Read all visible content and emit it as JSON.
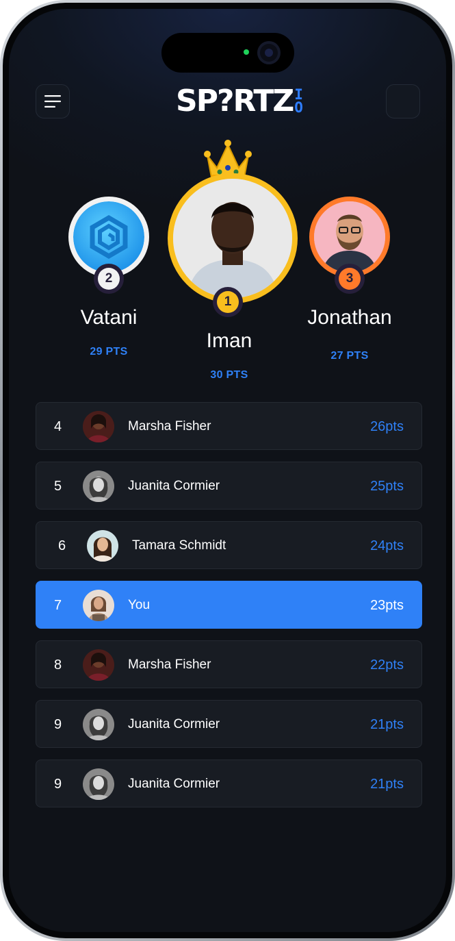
{
  "app": {
    "logo_main": "SP?RTZ",
    "logo_sub_top": "I",
    "logo_sub_bottom": "O"
  },
  "header": {
    "menu_icon": "hamburger-menu-icon"
  },
  "podium": {
    "first": {
      "rank": "1",
      "name": "Iman",
      "points": "30 PTS",
      "icon": "crown-icon",
      "ring_color": "#f9be1e"
    },
    "second": {
      "rank": "2",
      "name": "Vatani",
      "points": "29 PTS",
      "ring_color": "#f2f2f2",
      "avatar_icon": "hexagon-logo-icon"
    },
    "third": {
      "rank": "3",
      "name": "Jonathan",
      "points": "27 PTS",
      "ring_color": "#ff7a2a"
    }
  },
  "leaderboard": [
    {
      "rank": "4",
      "name": "Marsha Fisher",
      "points": "26pts"
    },
    {
      "rank": "5",
      "name": "Juanita Cormier",
      "points": "25pts"
    },
    {
      "rank": "6",
      "name": "Tamara Schmidt",
      "points": "24pts"
    },
    {
      "rank": "7",
      "name": "You",
      "points": "23pts",
      "highlighted": true
    },
    {
      "rank": "8",
      "name": "Marsha Fisher",
      "points": "22pts"
    },
    {
      "rank": "9",
      "name": "Juanita Cormier",
      "points": "21pts"
    },
    {
      "rank": "9",
      "name": "Juanita Cormier",
      "points": "21pts"
    }
  ],
  "colors": {
    "accent": "#2f81f7",
    "gold": "#f9be1e",
    "bronze": "#ff7a2a",
    "background": "#0f1218"
  }
}
